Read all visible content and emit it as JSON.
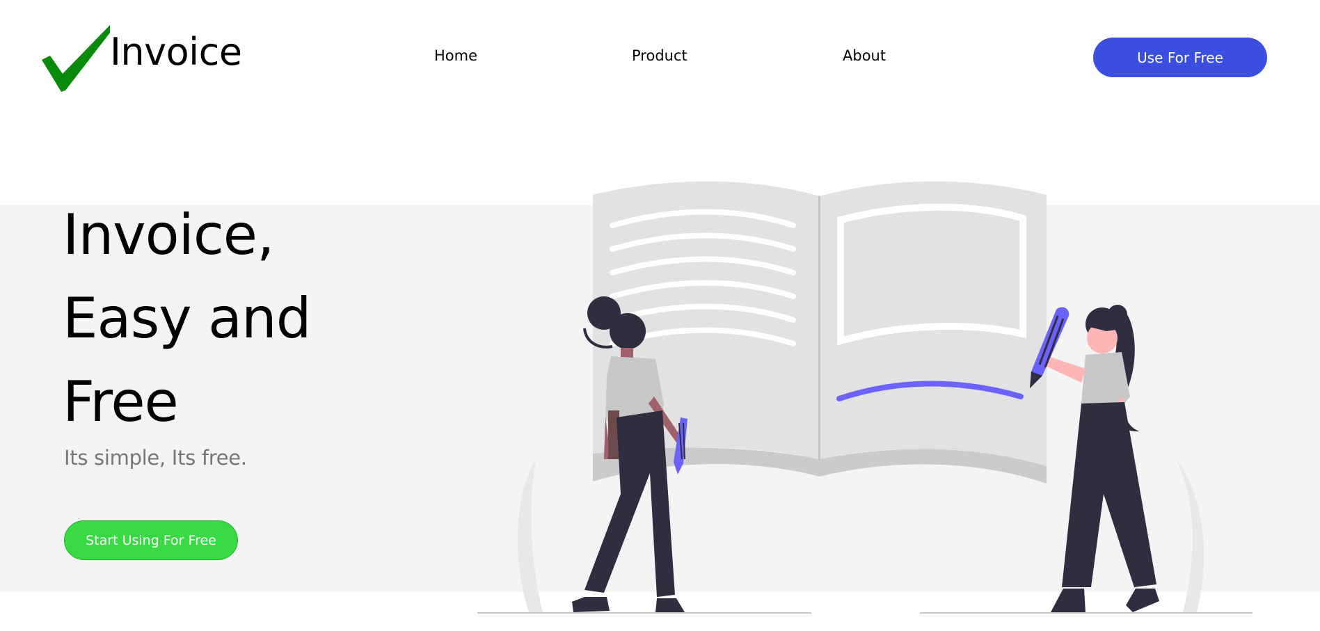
{
  "brand": {
    "name": "Invoice",
    "logo_icon": "checkmark-icon"
  },
  "nav": {
    "items": [
      {
        "label": "Home"
      },
      {
        "label": "Product"
      },
      {
        "label": "About"
      }
    ],
    "cta_label": "Use For Free"
  },
  "hero": {
    "title_lines": [
      "Invoice,",
      "Easy and",
      "Free"
    ],
    "subtitle": "Its simple, Its free.",
    "cta_label": "Start Using For Free"
  },
  "colors": {
    "primary": "#3b4fdf",
    "accent_green": "#38d943",
    "logo_check": "#0a8a0a",
    "band_bg": "#f4f4f4",
    "illustration_purple": "#6c63ff",
    "illustration_dark": "#2f2e41"
  }
}
